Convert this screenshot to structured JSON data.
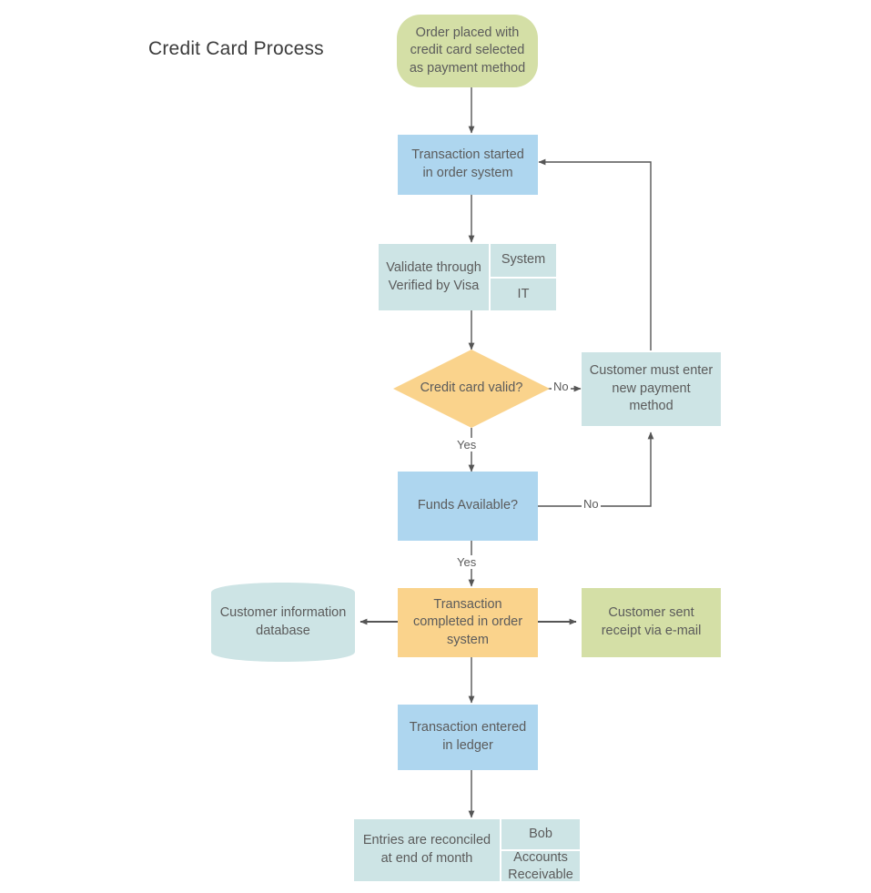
{
  "diagram": {
    "title": "Credit Card Process",
    "colors": {
      "green": "#d4dfa6",
      "blue": "#aed6ef",
      "cyan": "#cde4e5",
      "orange": "#fad38c",
      "line": "#555555",
      "text": "#5b5b5b",
      "title_text": "#3b3b3b",
      "background": "#ffffff"
    },
    "nodes": {
      "start": {
        "label": "Order placed with credit card selected as payment method",
        "shape": "stadium",
        "color": "green"
      },
      "transaction_started": {
        "label": "Transaction started in order system",
        "shape": "rectangle",
        "color": "blue"
      },
      "validate": {
        "label": "Validate through Verified by Visa",
        "shape": "rectangle-split",
        "color": "cyan",
        "side_cells": [
          "System",
          "IT"
        ]
      },
      "credit_card_valid": {
        "label": "Credit card valid?",
        "shape": "diamond",
        "color": "orange"
      },
      "customer_new_payment": {
        "label": "Customer must enter new payment method",
        "shape": "rectangle",
        "color": "cyan"
      },
      "funds_available": {
        "label": "Funds Available?",
        "shape": "rectangle",
        "color": "blue"
      },
      "customer_db": {
        "label": "Customer information database",
        "shape": "cylinder",
        "color": "cyan"
      },
      "transaction_completed": {
        "label": "Transaction completed in order system",
        "shape": "rectangle",
        "color": "orange"
      },
      "receipt_email": {
        "label": "Customer sent receipt via e-mail",
        "shape": "rectangle",
        "color": "green"
      },
      "ledger": {
        "label": "Transaction entered in ledger",
        "shape": "rectangle",
        "color": "blue"
      },
      "reconciled": {
        "label": "Entries are reconciled at end of month",
        "shape": "rectangle-split",
        "color": "cyan",
        "side_cells": [
          "Bob",
          "Accounts Receivable"
        ]
      }
    },
    "edge_labels": {
      "valid_no": "No",
      "valid_yes": "Yes",
      "funds_no": "No",
      "funds_yes": "Yes"
    }
  }
}
